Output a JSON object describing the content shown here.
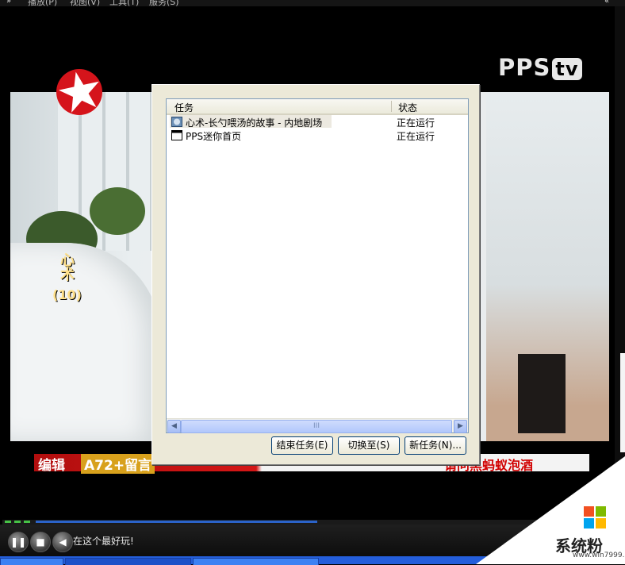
{
  "menu": {
    "items": [
      {
        "label": "播放(P)"
      },
      {
        "label": "视图(V)"
      },
      {
        "label": "工具(T)"
      },
      {
        "label": "服务(S)"
      }
    ],
    "left_arrow": "»",
    "right_arrow": "«"
  },
  "video": {
    "brand": "PPS",
    "brand_suffix": "tv",
    "episode_title": "心术",
    "episode_number": "(10)",
    "ticker_left": "编辑",
    "ticker_mid": "A72+留言",
    "ticker_right": "请问黑蚂蚁泡酒"
  },
  "task_manager": {
    "columns": {
      "task": "任务",
      "status": "状态"
    },
    "rows": [
      {
        "name": "心术-长勺喂汤的故事 - 内地剧场",
        "status": "正在运行",
        "icon": "player-app-icon"
      },
      {
        "name": "PPS迷你首页",
        "status": "正在运行",
        "icon": "window-app-icon"
      }
    ],
    "scroll_grip": "III",
    "buttons": {
      "end_task": "结束任务(E)",
      "switch_to": "切换至(S)",
      "new_task": "新任务(N)..."
    }
  },
  "player": {
    "status_text": "在这个最好玩!",
    "progress": 0.46
  },
  "watermark": {
    "text": "系统粉",
    "url": "www.win7999.com",
    "logo_colors": [
      "#f25022",
      "#7fba00",
      "#00a4ef",
      "#ffb900"
    ]
  }
}
